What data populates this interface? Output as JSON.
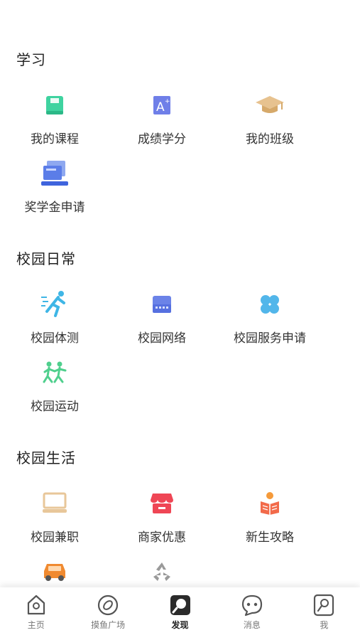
{
  "sections": [
    {
      "title": "学习",
      "items": [
        {
          "label": "我的课程",
          "icon": "course-book-icon"
        },
        {
          "label": "成绩学分",
          "icon": "grade-a-plus-icon"
        },
        {
          "label": "我的班级",
          "icon": "graduation-cap-icon"
        },
        {
          "label": "奖学金申请",
          "icon": "scholarship-card-icon"
        }
      ]
    },
    {
      "title": "校园日常",
      "items": [
        {
          "label": "校园体测",
          "icon": "running-person-icon"
        },
        {
          "label": "校园网络",
          "icon": "network-router-icon"
        },
        {
          "label": "校园服务申请",
          "icon": "clover-service-icon"
        },
        {
          "label": "校园运动",
          "icon": "sports-people-icon"
        }
      ]
    },
    {
      "title": "校园生活",
      "items": [
        {
          "label": "校园兼职",
          "icon": "laptop-icon"
        },
        {
          "label": "商家优惠",
          "icon": "shop-store-icon"
        },
        {
          "label": "新生攻略",
          "icon": "reading-person-icon"
        },
        {
          "label": "",
          "icon": "car-icon"
        },
        {
          "label": "",
          "icon": "recycle-icon"
        }
      ]
    }
  ],
  "tabbar": [
    {
      "label": "主页",
      "icon": "home-icon",
      "active": false
    },
    {
      "label": "摸鱼广场",
      "icon": "fish-plaza-icon",
      "active": false
    },
    {
      "label": "发现",
      "icon": "discover-icon",
      "active": true
    },
    {
      "label": "消息",
      "icon": "message-icon",
      "active": false
    },
    {
      "label": "我",
      "icon": "profile-icon",
      "active": false
    }
  ],
  "colors": {
    "course": "#3fd3a0",
    "grade": "#6f7fe8",
    "cap": "#e7c28f",
    "scholarship": "#5b7de8",
    "run": "#3fb6e6",
    "network": "#6b83e8",
    "clover": "#52b6ea",
    "sport": "#4fcf8d",
    "laptop": "#e8c79a",
    "shop": "#ef4655",
    "reading": "#f26a4a",
    "car": "#f08a30",
    "recycle": "#9a9a9a"
  }
}
